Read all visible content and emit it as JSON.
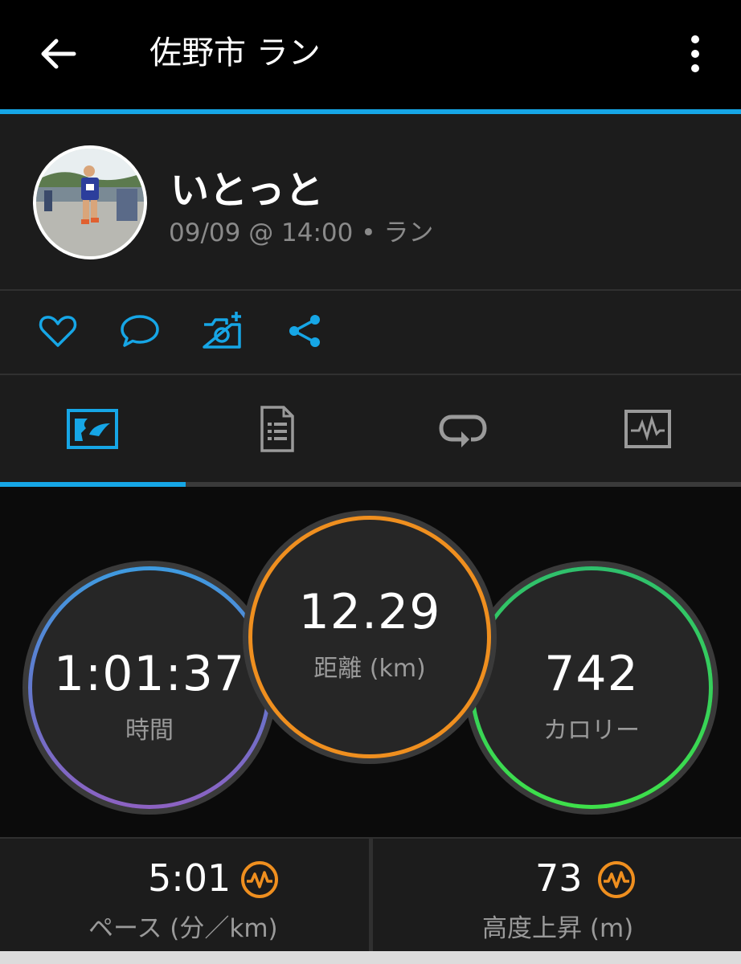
{
  "header": {
    "title": "佐野市 ラン"
  },
  "profile": {
    "name": "いとっと",
    "meta": "09/09 @ 14:00 • ラン"
  },
  "colors": {
    "accent": "#16a6e6",
    "time_ring": "#6b72c9",
    "distance_ring": "#ef8f1f",
    "calorie_ring": "#3ee04a",
    "badge": "#ef8f1f"
  },
  "actions": [
    "heart-icon",
    "comment-icon",
    "add-photo-icon",
    "share-icon"
  ],
  "tabs": [
    "map-summary-icon",
    "details-icon",
    "laps-icon",
    "graph-icon"
  ],
  "stats": {
    "time": {
      "value": "1:01:37",
      "label": "時間"
    },
    "distance": {
      "value": "12.29",
      "label": "距離 (km)"
    },
    "calories": {
      "value": "742",
      "label": "カロリー"
    }
  },
  "bottom": {
    "pace": {
      "value": "5:01",
      "label": "ペース (分／km)"
    },
    "elevation": {
      "value": "73",
      "label": "高度上昇 (m)"
    }
  }
}
